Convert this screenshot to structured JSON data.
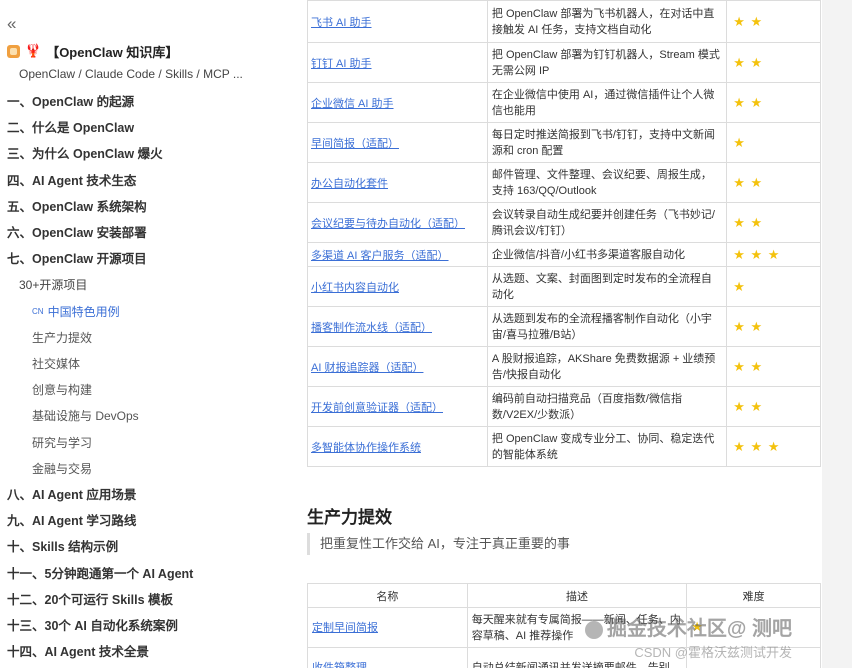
{
  "sidebar": {
    "collapse_icon": "«",
    "book_title": "【OpenClaw 知识库】",
    "book_emoji": "🦞",
    "subtitle": "OpenClaw / Claude Code / Skills / MCP ...",
    "items": [
      {
        "label": "一、OpenClaw 的起源",
        "level": 1
      },
      {
        "label": "二、什么是 OpenClaw",
        "level": 1
      },
      {
        "label": "三、为什么 OpenClaw 爆火",
        "level": 1
      },
      {
        "label": "四、AI Agent 技术生态",
        "level": 1
      },
      {
        "label": "五、OpenClaw 系统架构",
        "level": 1
      },
      {
        "label": "六、OpenClaw 安装部署",
        "level": 1
      },
      {
        "label": "七、OpenClaw 开源项目",
        "level": 1
      },
      {
        "label": "30+开源项目",
        "level": 2
      },
      {
        "label": "中国特色用例",
        "level": 3,
        "active": true,
        "prefix": "CN"
      },
      {
        "label": "生产力提效",
        "level": 3
      },
      {
        "label": "社交媒体",
        "level": 3
      },
      {
        "label": "创意与构建",
        "level": 3
      },
      {
        "label": "基础设施与 DevOps",
        "level": 3
      },
      {
        "label": "研究与学习",
        "level": 3
      },
      {
        "label": "金融与交易",
        "level": 3
      },
      {
        "label": "八、AI Agent 应用场景",
        "level": 1
      },
      {
        "label": "九、AI Agent 学习路线",
        "level": 1
      },
      {
        "label": "十、Skills 结构示例",
        "level": 1
      },
      {
        "label": "十一、5分钟跑通第一个 AI Agent",
        "level": 1
      },
      {
        "label": "十二、20个可运行 Skills 模板",
        "level": 1
      },
      {
        "label": "十三、30个 AI 自动化系统案例",
        "level": 1
      },
      {
        "label": "十四、AI Agent 技术全景",
        "level": 1
      }
    ]
  },
  "table1": {
    "rows": [
      {
        "name": "飞书 AI 助手",
        "desc": "把 OpenClaw 部署为飞书机器人，在对话中直接触发 AI 任务，支持文档自动化",
        "stars": "★ ★"
      },
      {
        "name": "钉钉 AI 助手",
        "desc": "把 OpenClaw 部署为钉钉机器人，Stream 模式无需公网 IP",
        "stars": "★ ★"
      },
      {
        "name": "企业微信 AI 助手",
        "desc": "在企业微信中使用 AI，通过微信插件让个人微信也能用",
        "stars": "★ ★"
      },
      {
        "name": "早间简报（适配）",
        "desc": "每日定时推送简报到飞书/钉钉，支持中文新闻源和 cron 配置",
        "stars": "★"
      },
      {
        "name": "办公自动化套件",
        "desc": "邮件管理、文件整理、会议纪要、周报生成，支持 163/QQ/Outlook",
        "stars": "★ ★"
      },
      {
        "name": "会议纪要与待办自动化（适配）",
        "desc": "会议转录自动生成纪要并创建任务（飞书妙记/腾讯会议/钉钉）",
        "stars": "★ ★"
      },
      {
        "name": "多渠道 AI 客户服务（适配）",
        "desc": "企业微信/抖音/小红书多渠道客服自动化",
        "stars": "★ ★ ★"
      },
      {
        "name": "小红书内容自动化",
        "desc": "从选题、文案、封面图到定时发布的全流程自动化",
        "stars": "★"
      },
      {
        "name": "播客制作流水线（适配）",
        "desc": "从选题到发布的全流程播客制作自动化（小宇宙/喜马拉雅/B站）",
        "stars": "★ ★"
      },
      {
        "name": "AI 财报追踪器（适配）",
        "desc": "A 股财报追踪，AKShare 免费数据源 + 业绩预告/快报自动化",
        "stars": "★ ★"
      },
      {
        "name": "开发前创意验证器（适配）",
        "desc": "编码前自动扫描竞品（百度指数/微信指数/V2EX/少数派）",
        "stars": "★ ★"
      },
      {
        "name": "多智能体协作操作系统",
        "desc": "把 OpenClaw 变成专业分工、协同、稳定迭代的智能体系统",
        "stars": "★ ★ ★"
      }
    ]
  },
  "section": {
    "title": "生产力提效",
    "quote": "把重复性工作交给 AI，专注于真正重要的事"
  },
  "table2": {
    "headers": [
      "名称",
      "描述",
      "难度"
    ],
    "rows": [
      {
        "name": "定制早间简报",
        "desc": "每天醒来就有专属简报——新闻、任务、内容草稿、AI 推荐操作",
        "stars": "★"
      },
      {
        "name": "收件箱整理",
        "desc": "自动总结新闻通讯并发送摘要邮件，告别",
        "stars": ""
      }
    ]
  },
  "watermark": {
    "main": "掘金技术社区@ 测吧",
    "sub": "CSDN @霍格沃兹测试开发"
  },
  "colors": {
    "link": "#3b6fd6",
    "star": "#f4c20d",
    "active_nav": "#3b6fd6"
  }
}
